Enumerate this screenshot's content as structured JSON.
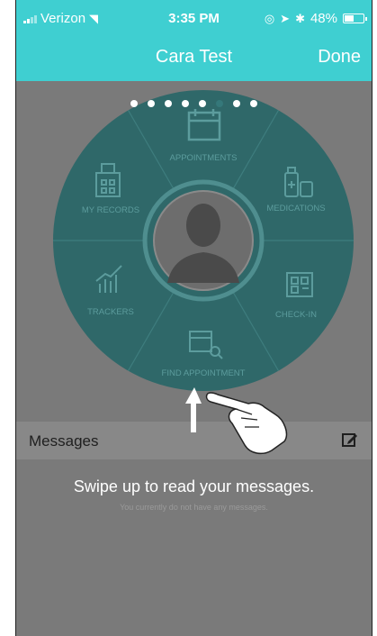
{
  "status_bar": {
    "carrier": "Verizon",
    "time": "3:35 PM",
    "battery": "48%",
    "battery_level": 0.48
  },
  "nav": {
    "title": "Cara Test",
    "done_label": "Done"
  },
  "dial": {
    "page_indicator": {
      "count": 8,
      "active_indices": [
        0,
        1,
        2,
        3,
        4,
        6,
        7
      ],
      "dim_index": 5
    },
    "segments": [
      {
        "label": "APPOINTMENTS",
        "icon": "calendar-icon"
      },
      {
        "label": "MEDICATIONS",
        "icon": "medication-bottles-icon"
      },
      {
        "label": "CHECK-IN",
        "icon": "qr-code-icon"
      },
      {
        "label": "FIND APPOINTMENT",
        "icon": "calendar-search-icon"
      },
      {
        "label": "TRACKERS",
        "icon": "trend-chart-icon"
      },
      {
        "label": "MY RECORDS",
        "icon": "hospital-building-icon"
      }
    ],
    "center": {
      "icon": "user-avatar-icon"
    }
  },
  "messages": {
    "title": "Messages",
    "swipe_hint": "Swipe up to read your messages.",
    "empty_state": "You currently do not have any messages."
  },
  "colors": {
    "nav_bg": "#3fcfd1",
    "dial_bg": "#2f6869",
    "overlay_bg": "#7a7a7a"
  }
}
